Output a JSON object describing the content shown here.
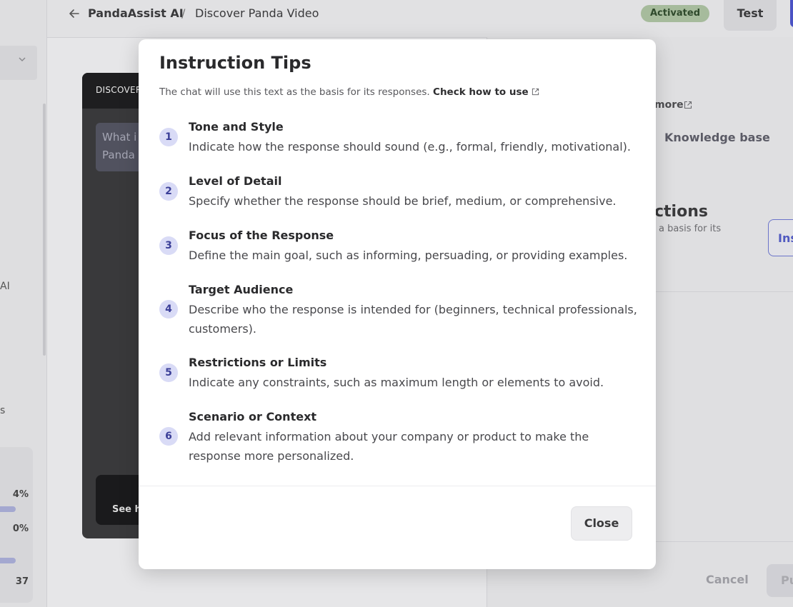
{
  "breadcrumb": {
    "primary": "PandaAssist AI",
    "separator": "/",
    "secondary": "Discover Panda Video"
  },
  "header": {
    "status_badge": "Activated",
    "test_button": "Test"
  },
  "sidebar": {
    "frag_ai": "AI",
    "frag_s": "s",
    "stats": [
      "4%",
      "0%",
      "37"
    ]
  },
  "preview": {
    "title": "DISCOVER",
    "message_line1": "What i",
    "message_line2": "Panda",
    "footer_text": "See h"
  },
  "right_panel": {
    "learn_more": "more",
    "knowledge_base": "Knowledge base",
    "heading": "ctions",
    "subtext": "a basis for its",
    "instructions_button": "Ins",
    "cancel_button": "Cancel",
    "publish_button": "Pu"
  },
  "modal": {
    "title": "Instruction Tips",
    "description": "The chat will use this text as the basis for its responses.",
    "link": "Check how to use",
    "tips": [
      {
        "num": "1",
        "title": "Tone and Style",
        "desc": "Indicate how the response should sound (e.g., formal, friendly, motivational)."
      },
      {
        "num": "2",
        "title": "Level of Detail",
        "desc": "Specify whether the response should be brief, medium, or comprehensive."
      },
      {
        "num": "3",
        "title": "Focus of the Response",
        "desc": "Define the main goal, such as informing, persuading, or providing examples."
      },
      {
        "num": "4",
        "title": "Target Audience",
        "desc": "Describe who the response is intended for (beginners, technical professionals, customers)."
      },
      {
        "num": "5",
        "title": "Restrictions or Limits",
        "desc": "Indicate any constraints, such as maximum length or elements to avoid."
      },
      {
        "num": "6",
        "title": "Scenario or Context",
        "desc": "Add relevant information about your company or product to make the response more personalized."
      }
    ],
    "close_button": "Close"
  },
  "colors": {
    "accent": "#4a52c4",
    "badge_bg": "#a6bb9c",
    "tip_number_bg": "#d9dbf6"
  },
  "icons": [
    "back-arrow-icon",
    "chevron-down-icon",
    "external-link-icon"
  ]
}
